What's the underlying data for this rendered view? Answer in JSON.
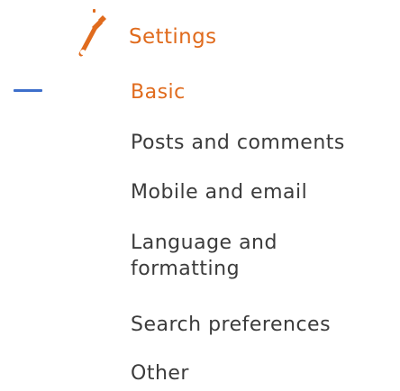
{
  "header": {
    "icon": "wrench-icon",
    "label": "Settings",
    "accent_color": "#e06b1d"
  },
  "nav": {
    "active_marker_color": "#3d6fcb",
    "items": [
      {
        "label": "Basic",
        "active": true
      },
      {
        "label": "Posts and comments",
        "active": false
      },
      {
        "label": "Mobile and email",
        "active": false
      },
      {
        "label": "Language and formatting",
        "active": false
      },
      {
        "label": "Search preferences",
        "active": false
      },
      {
        "label": "Other",
        "active": false
      }
    ]
  }
}
